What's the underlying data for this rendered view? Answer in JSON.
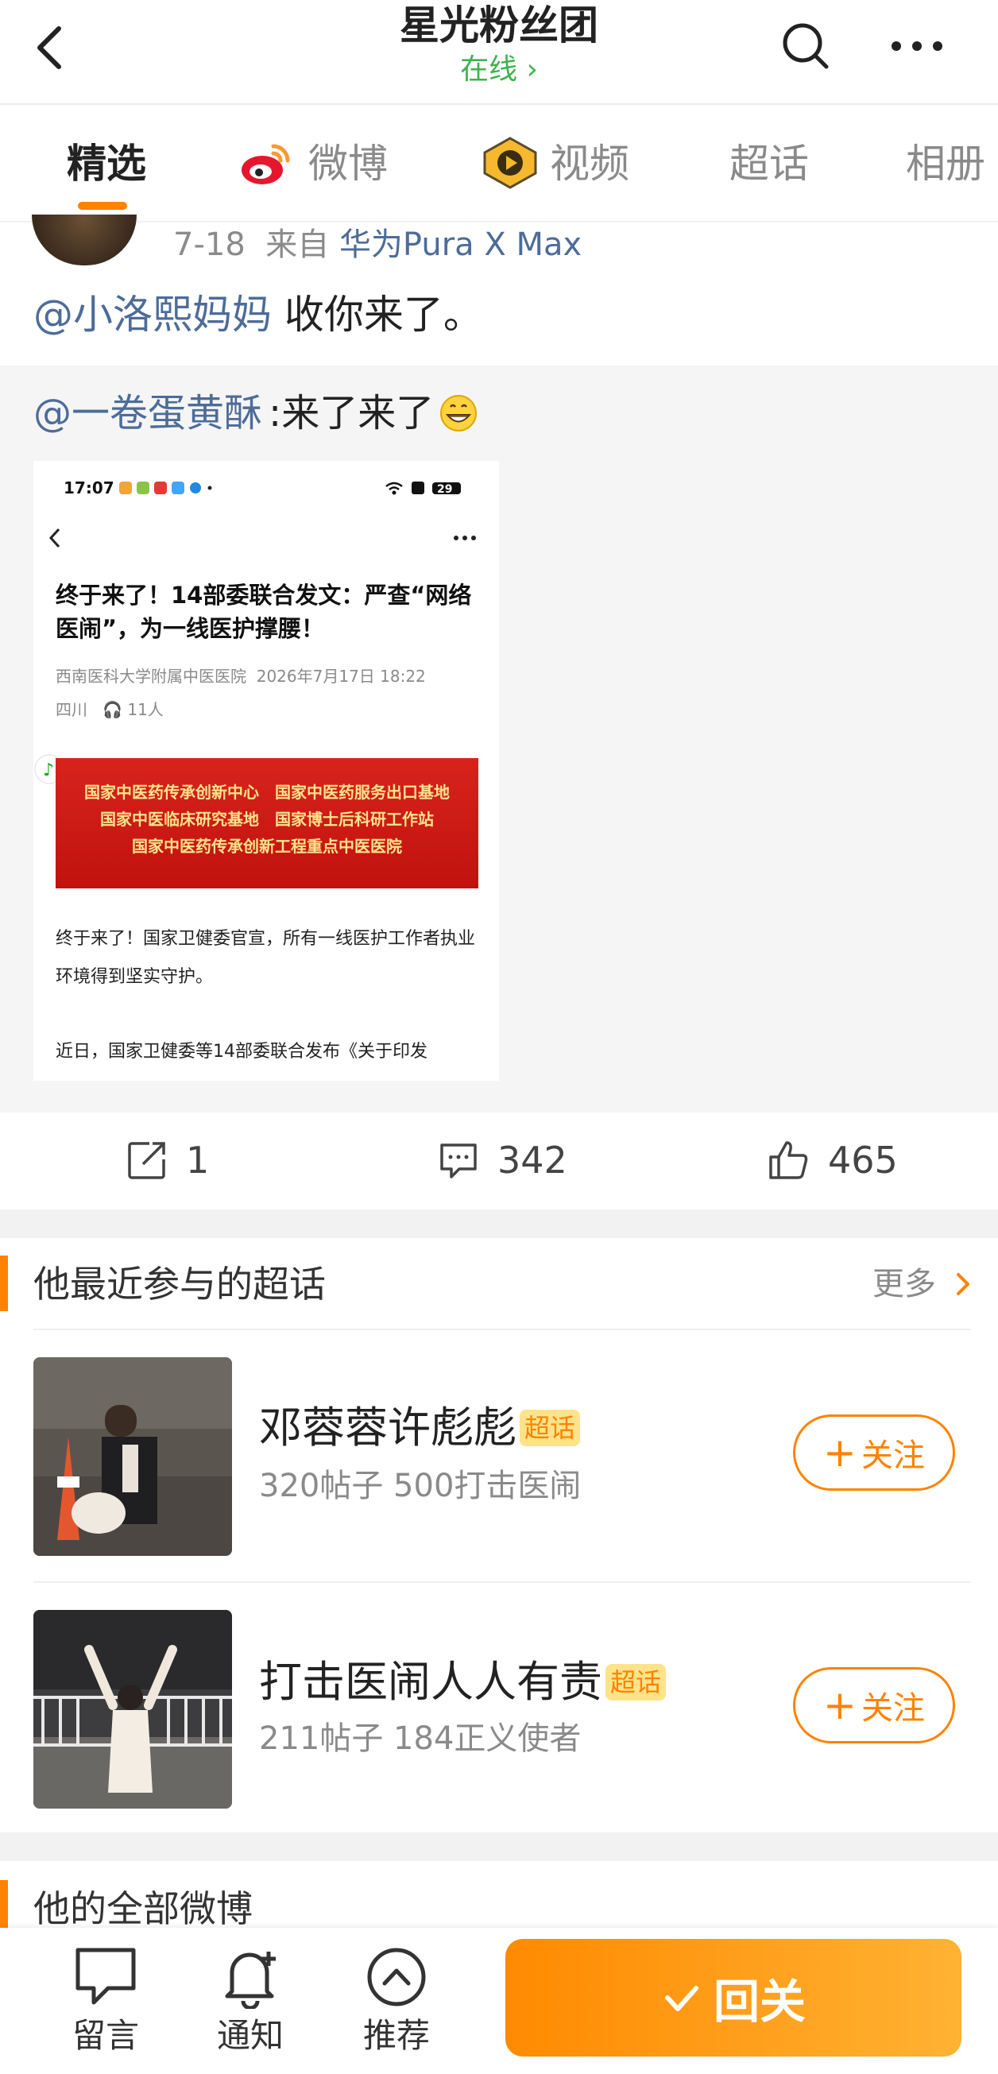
{
  "header": {
    "title": "星光粉丝团",
    "status": "在线",
    "status_arrow": "›"
  },
  "tabs": [
    {
      "label": "精选"
    },
    {
      "label": "微博"
    },
    {
      "label": "视频"
    },
    {
      "label": "超话"
    },
    {
      "label": "相册"
    }
  ],
  "post": {
    "date": "7-18",
    "from_label": "来自",
    "device": "华为Pura X Max",
    "mention": "@小洛熙妈妈",
    "text": " 收你来了。",
    "repost": {
      "mention": "@一卷蛋黄酥",
      "text": ":来了来了",
      "screenshot": {
        "time": "17:07",
        "battery": "29",
        "article_title": "终于来了！14部委联合发文：严查“网络医闹”，为一线医护撑腰！",
        "org": "西南医科大学附属中医医院",
        "date": "2026年7月17日 18:22",
        "location": "四川",
        "listeners": "11人",
        "banner_lines": [
          "国家中医药传承创新中心　国家中医药服务出口基地",
          "国家中医临床研究基地　国家博士后科研工作站",
          "国家中医药传承创新工程重点中医医院"
        ],
        "body1": "终于来了！国家卫健委官宣，所有一线医护工作者执业环境得到坚实守护。",
        "body2": "近日，国家卫健委等14部委联合发布《关于印发"
      }
    },
    "actions": {
      "repost_count": "1",
      "comment_count": "342",
      "like_count": "465"
    }
  },
  "super_topics": {
    "title": "他最近参与的超话",
    "more": "更多",
    "badge": "超话",
    "follow_label": "关注",
    "items": [
      {
        "name": "邓蓉蓉许彪彪",
        "stats": "320帖子 500打击医闹"
      },
      {
        "name": "打击医闹人人有责",
        "stats": "211帖子 184正义使者"
      }
    ]
  },
  "all_weibo": {
    "title": "他的全部微博"
  },
  "bottom_bar": {
    "message": "留言",
    "notify": "通知",
    "recommend": "推荐",
    "cta": "回关"
  },
  "colors": {
    "accent": "#ff8200",
    "link": "#4d6c99",
    "online": "#3fb24d"
  }
}
